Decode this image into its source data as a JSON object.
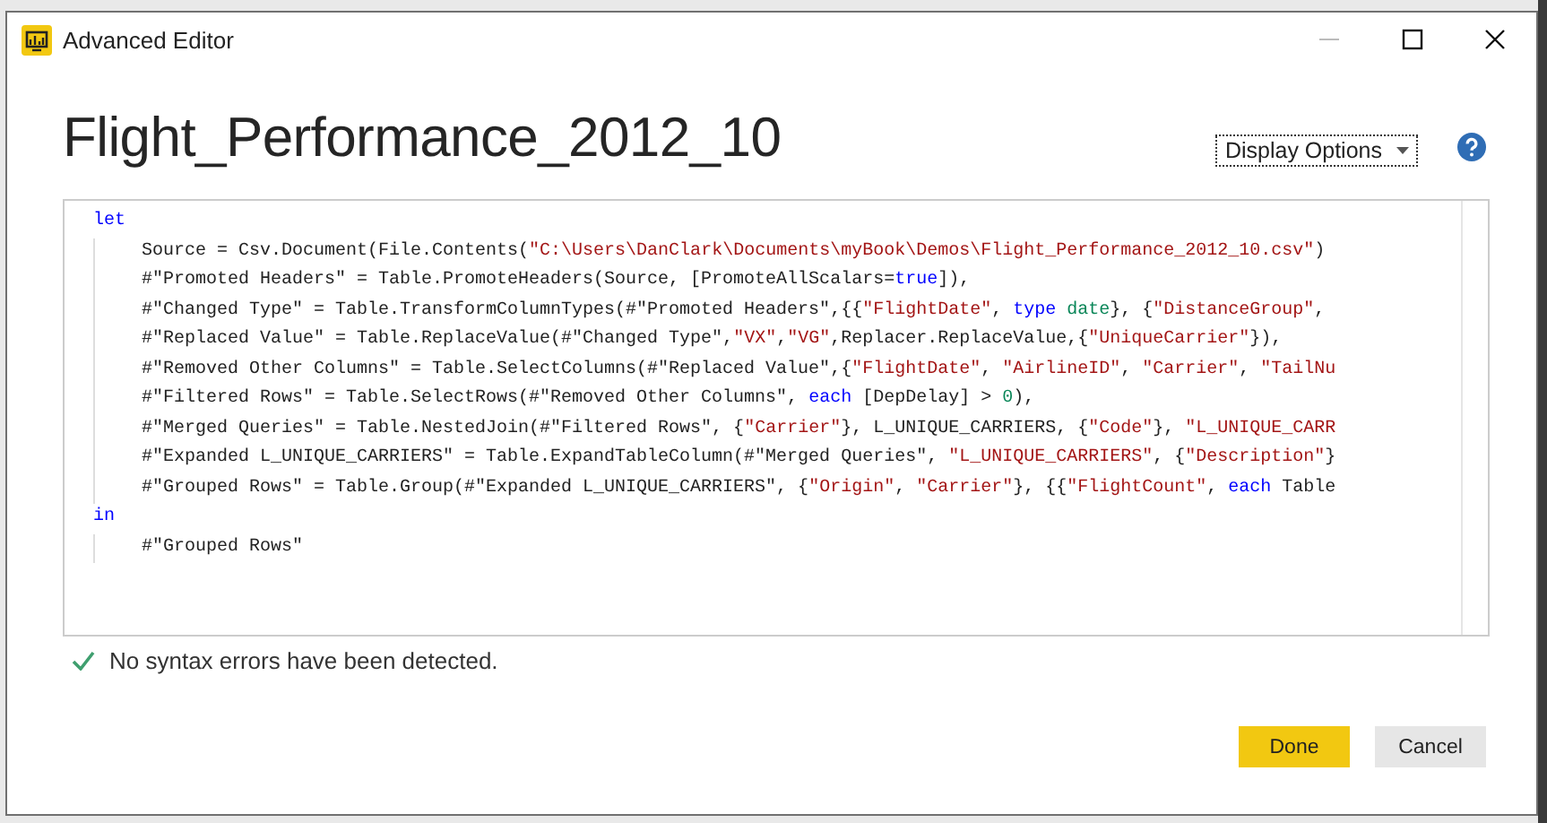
{
  "window": {
    "title": "Advanced Editor"
  },
  "heading": "Flight_Performance_2012_10",
  "display_options": {
    "label": "Display Options"
  },
  "code_lines": [
    {
      "kind": "block",
      "tokens": [
        {
          "kind": "keyword",
          "text": "let"
        }
      ]
    },
    {
      "kind": "body",
      "tokens": [
        {
          "kind": "plain",
          "text": "Source = Csv.Document(File.Contents("
        },
        {
          "kind": "string",
          "text": "\"C:\\Users\\DanClark\\Documents\\myBook\\Demos\\Flight_Performance_2012_10.csv\""
        },
        {
          "kind": "plain",
          "text": ")"
        }
      ]
    },
    {
      "kind": "body",
      "tokens": [
        {
          "kind": "plain",
          "text": "#\"Promoted Headers\" = Table.PromoteHeaders(Source, [PromoteAllScalars="
        },
        {
          "kind": "keyword",
          "text": "true"
        },
        {
          "kind": "plain",
          "text": "]),"
        }
      ]
    },
    {
      "kind": "body",
      "tokens": [
        {
          "kind": "plain",
          "text": "#\"Changed Type\" = Table.TransformColumnTypes(#\"Promoted Headers\",{{"
        },
        {
          "kind": "string",
          "text": "\"FlightDate\""
        },
        {
          "kind": "plain",
          "text": ", "
        },
        {
          "kind": "keyword",
          "text": "type"
        },
        {
          "kind": "type",
          "text": " date"
        },
        {
          "kind": "plain",
          "text": "}, {"
        },
        {
          "kind": "string",
          "text": "\"DistanceGroup\""
        },
        {
          "kind": "plain",
          "text": ","
        }
      ]
    },
    {
      "kind": "body",
      "tokens": [
        {
          "kind": "plain",
          "text": "#\"Replaced Value\" = Table.ReplaceValue(#\"Changed Type\","
        },
        {
          "kind": "string",
          "text": "\"VX\""
        },
        {
          "kind": "plain",
          "text": ","
        },
        {
          "kind": "string",
          "text": "\"VG\""
        },
        {
          "kind": "plain",
          "text": ",Replacer.ReplaceValue,{"
        },
        {
          "kind": "string",
          "text": "\"UniqueCarrier\""
        },
        {
          "kind": "plain",
          "text": "}),"
        }
      ]
    },
    {
      "kind": "body",
      "tokens": [
        {
          "kind": "plain",
          "text": "#\"Removed Other Columns\" = Table.SelectColumns(#\"Replaced Value\",{"
        },
        {
          "kind": "string",
          "text": "\"FlightDate\""
        },
        {
          "kind": "plain",
          "text": ", "
        },
        {
          "kind": "string",
          "text": "\"AirlineID\""
        },
        {
          "kind": "plain",
          "text": ", "
        },
        {
          "kind": "string",
          "text": "\"Carrier\""
        },
        {
          "kind": "plain",
          "text": ", "
        },
        {
          "kind": "string",
          "text": "\"TailNu"
        }
      ]
    },
    {
      "kind": "body",
      "tokens": [
        {
          "kind": "plain",
          "text": "#\"Filtered Rows\" = Table.SelectRows(#\"Removed Other Columns\", "
        },
        {
          "kind": "keyword",
          "text": "each"
        },
        {
          "kind": "plain",
          "text": " [DepDelay] > "
        },
        {
          "kind": "number",
          "text": "0"
        },
        {
          "kind": "plain",
          "text": "),"
        }
      ]
    },
    {
      "kind": "body",
      "tokens": [
        {
          "kind": "plain",
          "text": "#\"Merged Queries\" = Table.NestedJoin(#\"Filtered Rows\", {"
        },
        {
          "kind": "string",
          "text": "\"Carrier\""
        },
        {
          "kind": "plain",
          "text": "}, L_UNIQUE_CARRIERS, {"
        },
        {
          "kind": "string",
          "text": "\"Code\""
        },
        {
          "kind": "plain",
          "text": "}, "
        },
        {
          "kind": "string",
          "text": "\"L_UNIQUE_CARR"
        }
      ]
    },
    {
      "kind": "body",
      "tokens": [
        {
          "kind": "plain",
          "text": "#\"Expanded L_UNIQUE_CARRIERS\" = Table.ExpandTableColumn(#\"Merged Queries\", "
        },
        {
          "kind": "string",
          "text": "\"L_UNIQUE_CARRIERS\""
        },
        {
          "kind": "plain",
          "text": ", {"
        },
        {
          "kind": "string",
          "text": "\"Description\""
        },
        {
          "kind": "plain",
          "text": "}"
        }
      ]
    },
    {
      "kind": "body",
      "tokens": [
        {
          "kind": "plain",
          "text": "#\"Grouped Rows\" = Table.Group(#\"Expanded L_UNIQUE_CARRIERS\", {"
        },
        {
          "kind": "string",
          "text": "\"Origin\""
        },
        {
          "kind": "plain",
          "text": ", "
        },
        {
          "kind": "string",
          "text": "\"Carrier\""
        },
        {
          "kind": "plain",
          "text": "}, {{"
        },
        {
          "kind": "string",
          "text": "\"FlightCount\""
        },
        {
          "kind": "plain",
          "text": ", "
        },
        {
          "kind": "keyword",
          "text": "each"
        },
        {
          "kind": "plain",
          "text": " Table"
        }
      ]
    },
    {
      "kind": "block",
      "tokens": [
        {
          "kind": "keyword",
          "text": "in"
        }
      ]
    },
    {
      "kind": "body",
      "tokens": [
        {
          "kind": "plain",
          "text": "#\"Grouped Rows\""
        }
      ]
    }
  ],
  "status": {
    "message": "No syntax errors have been detected.",
    "valid": true
  },
  "buttons": [
    {
      "label": "Done",
      "kind": "primary"
    },
    {
      "label": "Cancel",
      "kind": "secondary"
    }
  ]
}
